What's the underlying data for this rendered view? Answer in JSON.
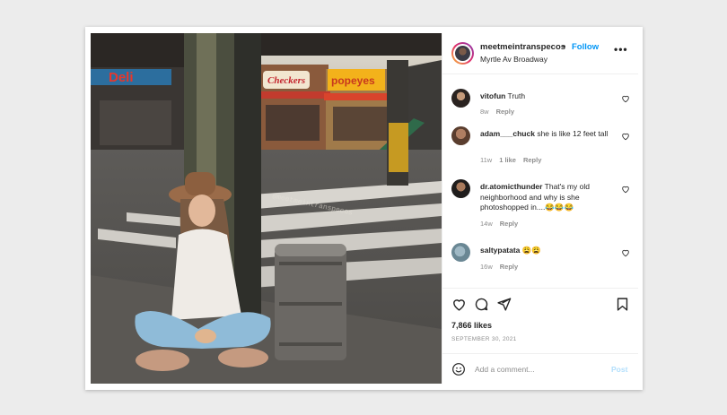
{
  "post": {
    "username": "meetmeintranspecos",
    "separator": "•",
    "follow_label": "Follow",
    "location": "Myrtle Av Broadway",
    "more_label": "•••"
  },
  "photo": {
    "signs": [
      "Deli",
      "Checkers",
      "popeyes"
    ],
    "watermark": "@meetmeintranspecos"
  },
  "comments": [
    {
      "username": "vitofun",
      "text": "Truth",
      "time": "8w",
      "likes": "",
      "reply": "Reply"
    },
    {
      "username": "adam___chuck",
      "text": "she is like 12 feet tall",
      "time": "11w",
      "likes": "1 like",
      "reply": "Reply"
    },
    {
      "username": "dr.atomicthunder",
      "text": "That's my old neighborhood and why is she photoshopped in....😂😂😂",
      "time": "14w",
      "likes": "",
      "reply": "Reply"
    },
    {
      "username": "saltypatata",
      "text": "😩😩",
      "time": "16w",
      "likes": "",
      "reply": "Reply"
    }
  ],
  "footer": {
    "likes": "7,866 likes",
    "date": "SEPTEMBER 30, 2021",
    "comment_placeholder": "Add a comment...",
    "post_label": "Post"
  },
  "icons": {
    "like": "heart-icon",
    "comment": "comment-bubble-icon",
    "share": "paper-plane-icon",
    "save": "bookmark-icon",
    "emoji": "smiley-icon",
    "comment_like": "small-heart-icon"
  },
  "colors": {
    "accent": "#0095f6",
    "post_disabled": "#b2dffc",
    "muted": "#8e8e8e"
  }
}
